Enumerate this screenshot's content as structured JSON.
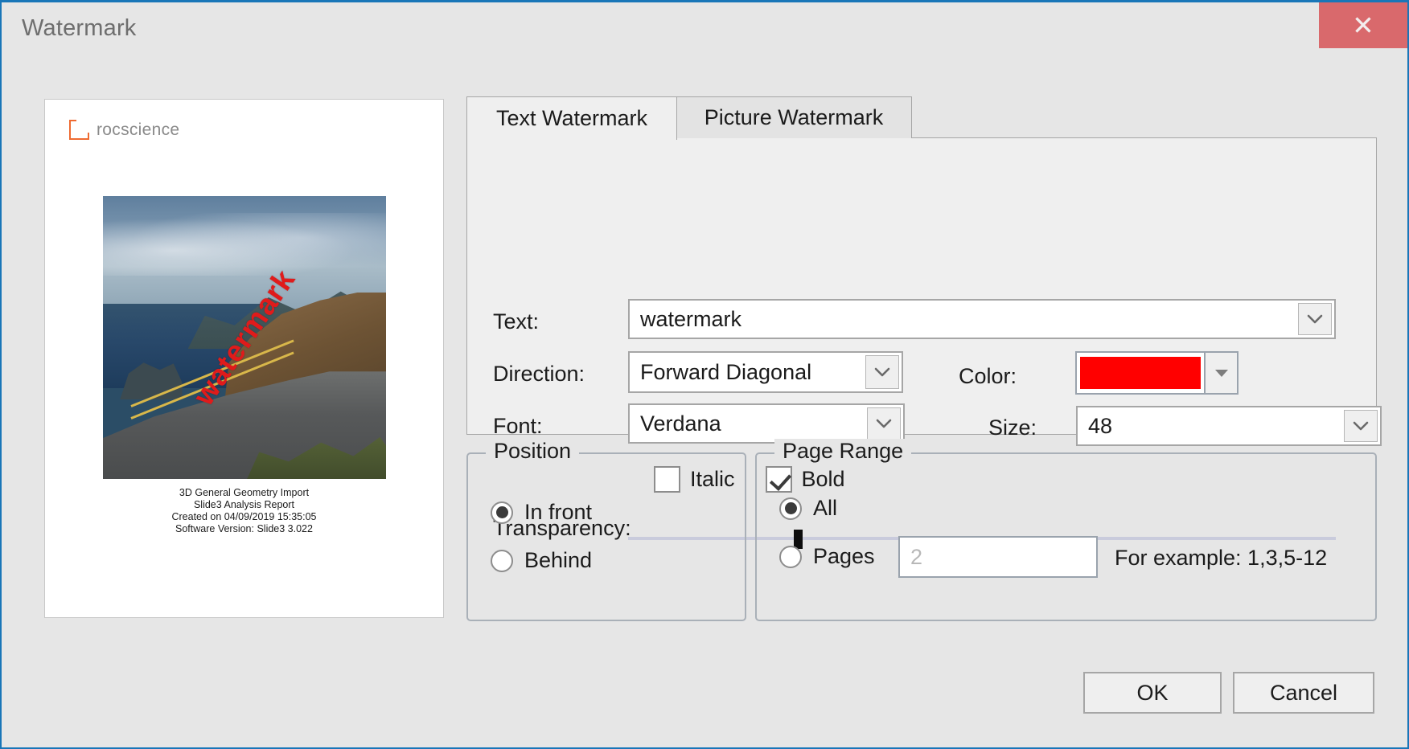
{
  "window": {
    "title": "Watermark",
    "close_label": "✕",
    "accent_color": "#1976b8",
    "close_button_color": "#d9696c"
  },
  "preview": {
    "brand": "rocscience",
    "watermark_text": "watermark",
    "watermark_color": "#e01b1b",
    "caption_lines": [
      "3D General Geometry Import",
      "Slide3 Analysis Report",
      "Created on 04/09/2019 15:35:05",
      "Software Version: Slide3 3.022"
    ]
  },
  "tabs": [
    {
      "label": "Text Watermark",
      "active": true
    },
    {
      "label": "Picture Watermark",
      "active": false
    }
  ],
  "text_watermark": {
    "text_label": "Text:",
    "text_value": "watermark",
    "direction_label": "Direction:",
    "direction_value": "Forward Diagonal",
    "color_label": "Color:",
    "color_value": "#ff0000",
    "font_label": "Font:",
    "font_value": "Verdana",
    "size_label": "Size:",
    "size_value": "48",
    "italic_label": "Italic",
    "italic_checked": false,
    "bold_label": "Bold",
    "bold_checked": true,
    "transparency_label": "Transparency:",
    "transparency_percent": 24
  },
  "position": {
    "group_title": "Position",
    "options": [
      {
        "label": "In front",
        "selected": true
      },
      {
        "label": "Behind",
        "selected": false
      }
    ]
  },
  "page_range": {
    "group_title": "Page Range",
    "all_label": "All",
    "all_selected": true,
    "pages_label": "Pages",
    "pages_selected": false,
    "pages_placeholder": "2",
    "example_hint": "For example: 1,3,5-12"
  },
  "footer": {
    "ok_label": "OK",
    "cancel_label": "Cancel"
  }
}
